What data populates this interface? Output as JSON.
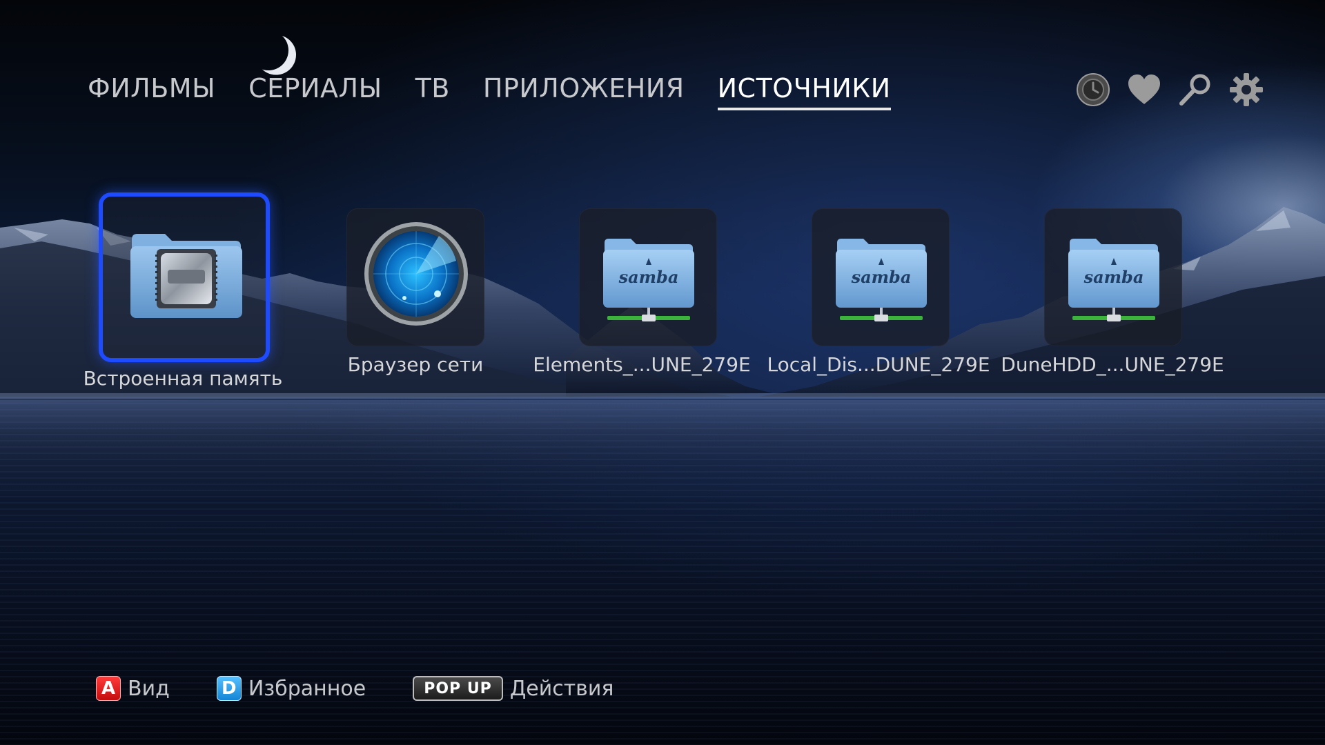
{
  "nav": {
    "tabs": [
      {
        "label": "ФИЛЬМЫ",
        "active": false
      },
      {
        "label": "СЕРИАЛЫ",
        "active": false
      },
      {
        "label": "ТВ",
        "active": false
      },
      {
        "label": "ПРИЛОЖЕНИЯ",
        "active": false
      },
      {
        "label": "ИСТОЧНИКИ",
        "active": true
      }
    ],
    "icons": [
      "history-icon",
      "favorites-heart-icon",
      "search-icon",
      "settings-gear-icon"
    ]
  },
  "sources": [
    {
      "label": "Встроенная память",
      "icon": "internal-storage-folder-icon",
      "focused": true
    },
    {
      "label": "Браузер сети",
      "icon": "network-radar-icon",
      "focused": false
    },
    {
      "label": "Elements_...UNE_279E",
      "icon": "samba-share-folder-icon",
      "focused": false
    },
    {
      "label": "Local_Dis...DUNE_279E",
      "icon": "samba-share-folder-icon",
      "focused": false
    },
    {
      "label": "DuneHDD_...UNE_279E",
      "icon": "samba-share-folder-icon",
      "focused": false
    }
  ],
  "samba_text": "samba",
  "hints": [
    {
      "key": "A",
      "label": "Вид",
      "color": "#e01f1f"
    },
    {
      "key": "D",
      "label": "Избранное",
      "color": "#2a9ef0"
    },
    {
      "key": "POP UP",
      "label": "Действия",
      "color": "#2b2b2b"
    }
  ],
  "colors": {
    "focus": "#1f4bff",
    "text": "#c7c9cd",
    "active_tab": "#ffffff"
  }
}
